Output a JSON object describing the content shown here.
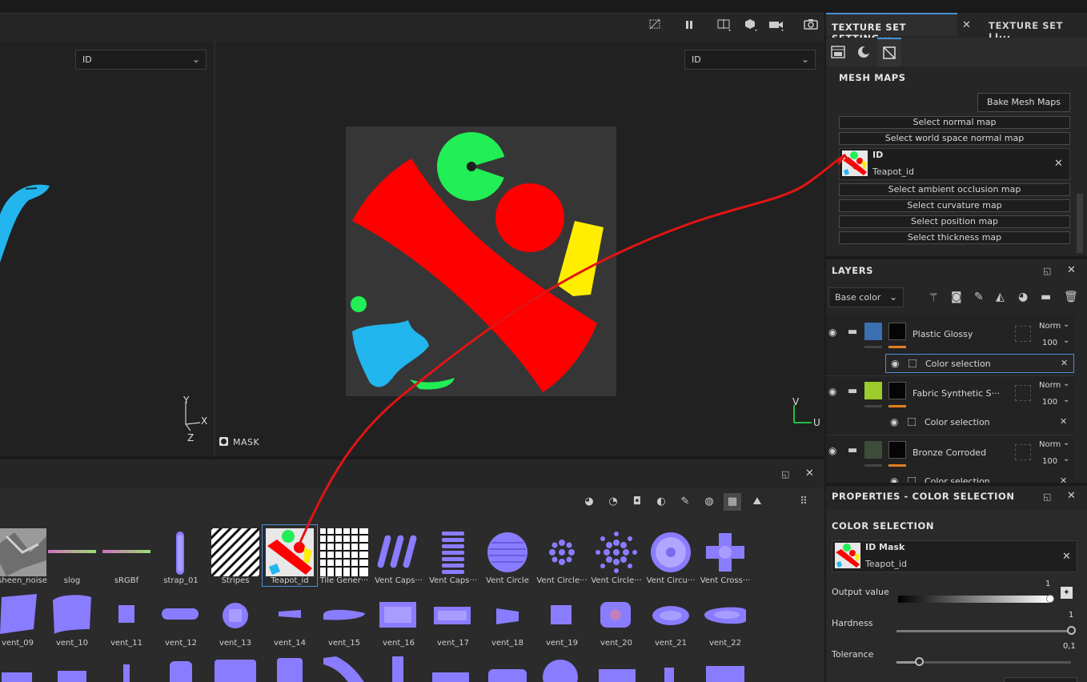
{
  "viewport": {
    "left_select": "ID",
    "right_select": "ID",
    "mask_label": "MASK",
    "axes_3d": {
      "y": "Y",
      "x": "X",
      "z": "Z"
    },
    "axes_uv": {
      "v": "V",
      "u": "U"
    }
  },
  "toolbar": {
    "icons": [
      "hide-icon",
      "pause-icon",
      "split-view-icon",
      "cube-icon",
      "camera-icon",
      "screenshot-icon"
    ]
  },
  "tabs": {
    "tab1": "TEXTURE SET SETTING···",
    "tab2": "TEXTURE SET LI···"
  },
  "mesh_maps": {
    "title": "MESH MAPS",
    "bake_button": "Bake Mesh Maps",
    "normal": "Select normal map",
    "world_normal": "Select world space normal map",
    "id_title": "ID",
    "id_name": "Teapot_id",
    "ao": "Select ambient occlusion map",
    "curvature": "Select curvature map",
    "position": "Select position map",
    "thickness": "Select thickness map"
  },
  "layers": {
    "title": "LAYERS",
    "channel": "Base color",
    "rows": [
      {
        "name": "Plastic Glossy",
        "blend": "Norm",
        "opacity": "100",
        "color": "#3a6fb0"
      },
      {
        "name": "Fabric Synthetic S···",
        "blend": "Norm",
        "opacity": "100",
        "color": "#9ccc2c"
      },
      {
        "name": "Bronze Corroded",
        "blend": "Norm",
        "opacity": "100",
        "color": "#3e4c3a"
      }
    ],
    "sub1": "Color selection",
    "sub2": "Color selection",
    "sub3": "Color selection"
  },
  "properties": {
    "title": "PROPERTIES - COLOR SELECTION",
    "section": "COLOR SELECTION",
    "mask_title": "ID Mask",
    "mask_name": "Teapot_id",
    "output_label": "Output value",
    "output_value": "1",
    "hardness_label": "Hardness",
    "hardness_value": "1",
    "tolerance_label": "Tolerance",
    "tolerance_value": "0,1"
  },
  "shelf": {
    "row1": [
      "sheen_noise",
      "slog",
      "sRGBf",
      "strap_01",
      "Stripes",
      "Teapot_id",
      "Tile Gener···",
      "Vent Caps···",
      "Vent Caps···",
      "Vent Circle",
      "Vent Circle···",
      "Vent Circle···",
      "Vent Circu···",
      "Vent Cross···"
    ],
    "row2": [
      "vent_09",
      "vent_10",
      "vent_11",
      "vent_12",
      "vent_13",
      "vent_14",
      "vent_15",
      "vent_16",
      "vent_17",
      "vent_18",
      "vent_19",
      "vent_20",
      "vent_21",
      "vent_22"
    ]
  },
  "colors": {
    "accent": "#4b8fd6",
    "id_red": "#ff0000",
    "id_green": "#22ee55",
    "id_blue": "#22b5ee",
    "id_yellow": "#ffee00",
    "normal_purple": "#8a7cff"
  }
}
